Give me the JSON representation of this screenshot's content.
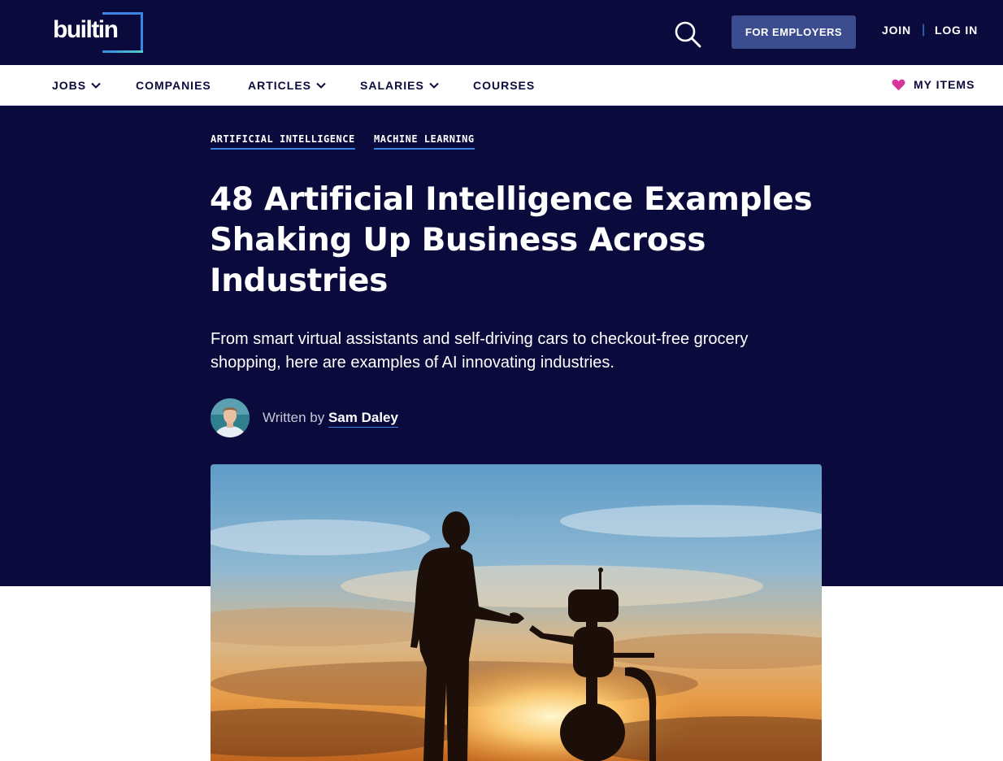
{
  "header": {
    "logo_text": "builtin",
    "for_employers_label": "FOR EMPLOYERS",
    "join_label": "JOIN",
    "separator": "|",
    "login_label": "LOG IN"
  },
  "nav": {
    "items": [
      {
        "label": "JOBS",
        "has_dropdown": true
      },
      {
        "label": "COMPANIES",
        "has_dropdown": false
      },
      {
        "label": "ARTICLES",
        "has_dropdown": true
      },
      {
        "label": "SALARIES",
        "has_dropdown": true
      },
      {
        "label": "COURSES",
        "has_dropdown": false
      }
    ],
    "my_items_label": "MY ITEMS"
  },
  "article": {
    "tags": [
      "ARTIFICIAL INTELLIGENCE",
      "MACHINE LEARNING"
    ],
    "title": "48 Artificial Intelligence Examples Shaking Up Business Across Industries",
    "subtitle": "From smart virtual assistants and self-driving cars to checkout-free grocery shopping, here are examples of AI innovating industries.",
    "written_by": "Written by",
    "author": "Sam Daley"
  },
  "colors": {
    "navy": "#0b0a3d",
    "accent_blue": "#3a86e0",
    "button_blue": "#3b4d8f",
    "heart_pink": "#d6359b"
  },
  "icons": {
    "search": "search-icon",
    "heart": "heart-icon",
    "chevron": "chevron-down-icon"
  }
}
